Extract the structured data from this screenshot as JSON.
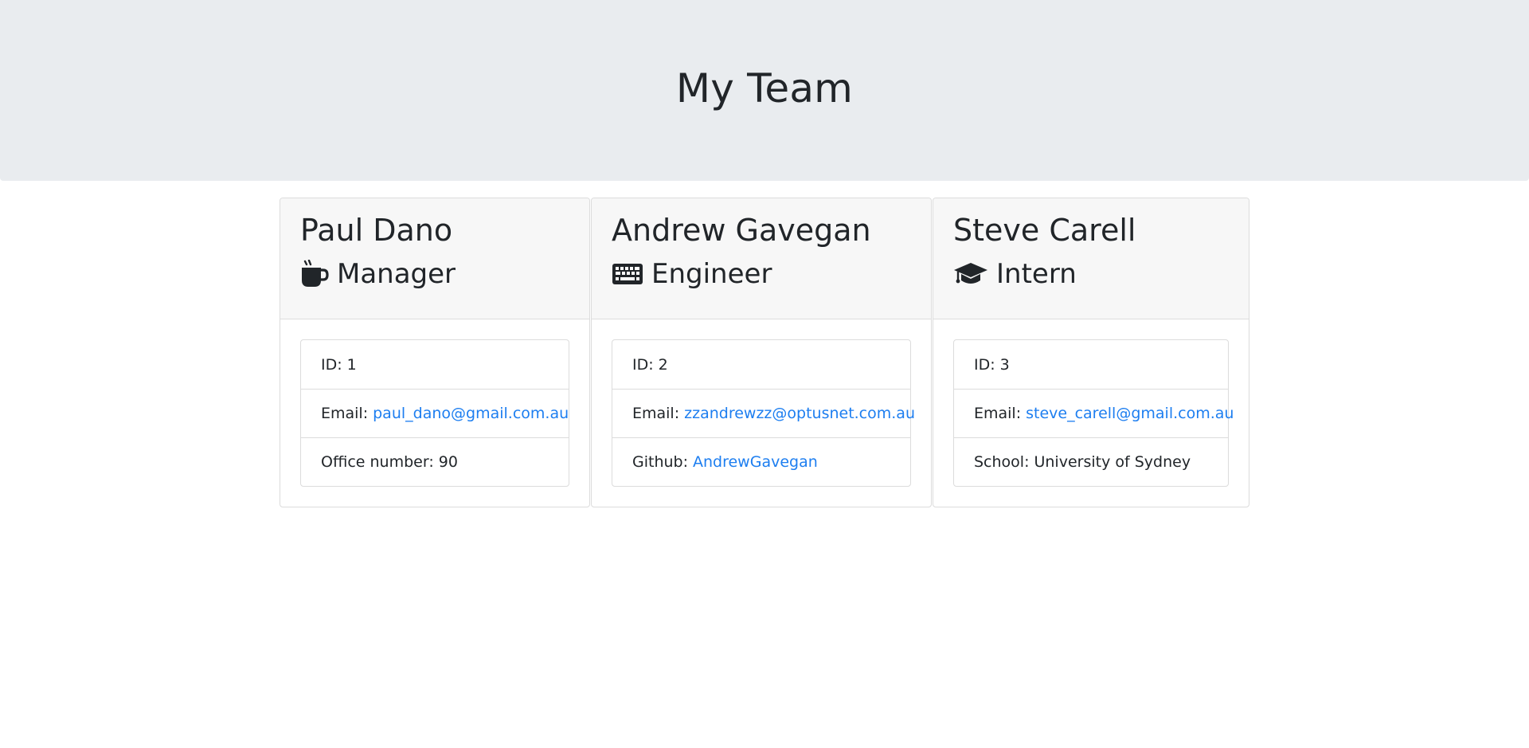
{
  "header": {
    "title": "My Team"
  },
  "team": [
    {
      "name": "Paul Dano",
      "role": "Manager",
      "icon": "coffee-mug-icon",
      "id_label": "ID:",
      "id_value": "1",
      "email_label": "Email:",
      "email": "paul_dano@gmail.com.au",
      "extra_label": "Office number:",
      "extra_value": "90"
    },
    {
      "name": "Andrew Gavegan",
      "role": "Engineer",
      "icon": "keyboard-icon",
      "id_label": "ID:",
      "id_value": "2",
      "email_label": "Email:",
      "email": "zzandrewzz@optusnet.com.au",
      "extra_label": "Github:",
      "extra_value": "AndrewGavegan"
    },
    {
      "name": "Steve Carell",
      "role": "Intern",
      "icon": "graduation-cap-icon",
      "id_label": "ID:",
      "id_value": "3",
      "email_label": "Email:",
      "email": "steve_carell@gmail.com.au",
      "extra_label": "School:",
      "extra_value": "University of Sydney"
    }
  ],
  "colors": {
    "jumbotron_bg": "#e9ecef",
    "card_header_bg": "#f7f7f7",
    "link": "#1d7ef0",
    "text": "#212529"
  }
}
